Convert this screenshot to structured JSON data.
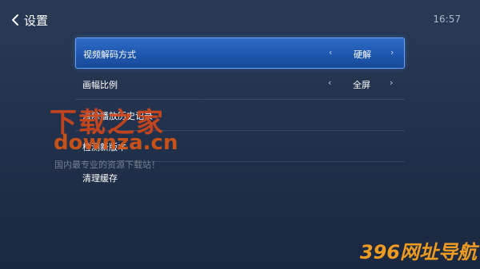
{
  "header": {
    "title": "设置",
    "time": "16:57",
    "back_icon": "chevron-left-icon"
  },
  "settings": [
    {
      "label": "视频解码方式",
      "value": "硬解",
      "selected": true
    },
    {
      "label": "画幅比例",
      "value": "全屏",
      "selected": false
    },
    {
      "label": "清除播放历史记录"
    },
    {
      "label": "检测新版本"
    },
    {
      "label": "清理缓存"
    }
  ],
  "arrows": {
    "left": "‹",
    "right": "›"
  },
  "watermark": {
    "site_name_cn": "下载之家",
    "site_domain": "downza.cn",
    "slogan": "国内最专业的资源下载站！",
    "corner_text": "396网址导航"
  },
  "colors": {
    "accent": "#1f58b0",
    "accent_border": "#6aa4f0",
    "watermark_orange": "#d2461a",
    "corner_orange": "#ffa51e"
  }
}
